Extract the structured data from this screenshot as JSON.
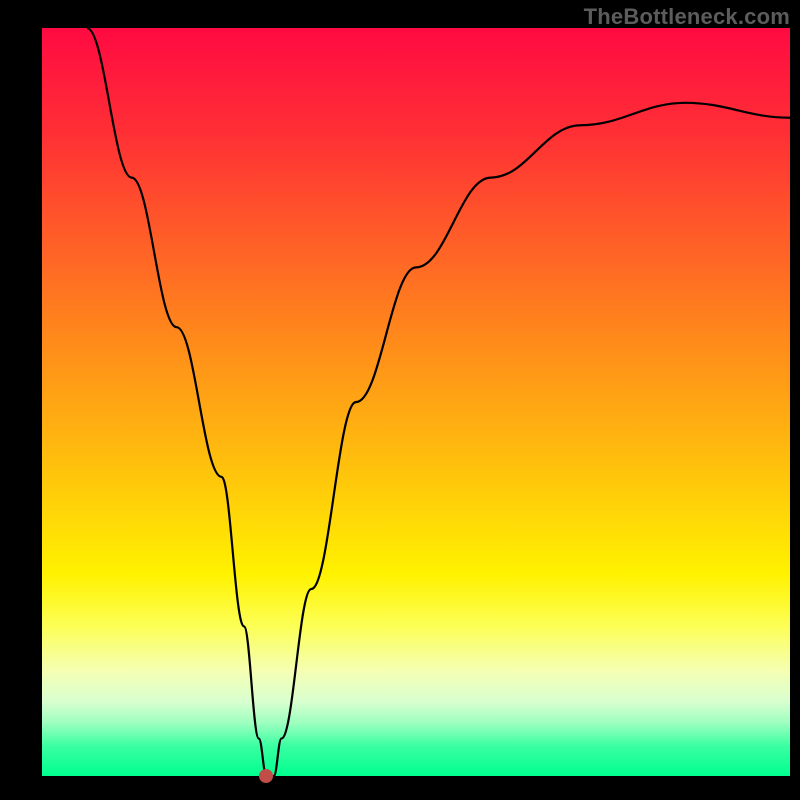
{
  "watermark": "TheBottleneck.com",
  "chart_data": {
    "type": "line",
    "title": "",
    "xlabel": "",
    "ylabel": "",
    "xlim": [
      0,
      100
    ],
    "ylim": [
      0,
      100
    ],
    "series": [
      {
        "name": "bottleneck-curve",
        "x": [
          6,
          12,
          18,
          24,
          27,
          29,
          30,
          31,
          32,
          36,
          42,
          50,
          60,
          72,
          86,
          100
        ],
        "values": [
          100,
          80,
          60,
          40,
          20,
          5,
          0,
          0,
          5,
          25,
          50,
          68,
          80,
          87,
          90,
          88
        ]
      }
    ],
    "marker": {
      "x": 30,
      "y": 0,
      "color": "#c24d48"
    },
    "grid": false,
    "legend": false
  },
  "colors": {
    "background": "#000000",
    "curve": "#000000",
    "marker": "#c24d48",
    "watermark": "#5c5c5c"
  }
}
